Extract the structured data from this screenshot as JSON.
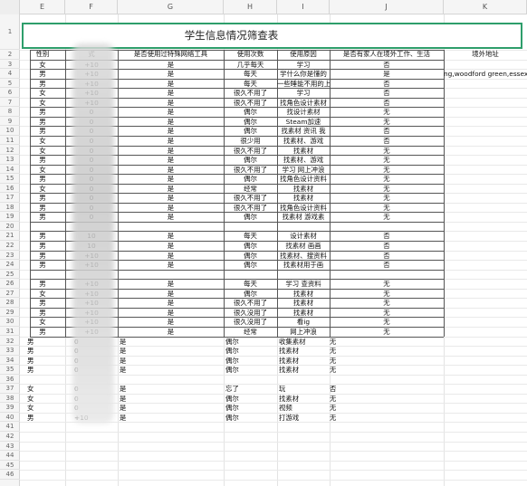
{
  "columns": [
    "E",
    "F",
    "G",
    "H",
    "I",
    "J",
    "K"
  ],
  "row_numbers": [
    "1",
    "2",
    "3",
    "4",
    "5",
    "6",
    "7",
    "8",
    "9",
    "10",
    "11",
    "12",
    "13",
    "14",
    "15",
    "16",
    "17",
    "18",
    "19",
    "20",
    "21",
    "22",
    "23",
    "24",
    "25",
    "26",
    "27",
    "28",
    "29",
    "30",
    "31",
    "32",
    "33",
    "34",
    "35",
    "36",
    "37",
    "38",
    "39",
    "40",
    "41",
    "42",
    "43",
    "44",
    "45",
    "46"
  ],
  "title": "学生信息情况筛查表",
  "headers": {
    "gender": "性别",
    "mode": "式",
    "used_tool": "是否使用过特殊网络工具",
    "frequency": "使用次数",
    "reason": "使用原因",
    "family_abroad": "是否有家人在境外工作、生活",
    "overseas_addr": "境外地址"
  },
  "rows": [
    {
      "g": "女",
      "f": "+10",
      "u": "是",
      "n": "几乎每天",
      "r": "学习",
      "a": "否",
      "o": ""
    },
    {
      "g": "男",
      "f": "+10",
      "u": "是",
      "n": "每天",
      "r": "学什么你是懂的",
      "a": "是",
      "o": "ng,woodford green,essex"
    },
    {
      "g": "男",
      "f": "+10",
      "u": "是",
      "n": "每天",
      "r": "一些睡能不用的上",
      "a": "否",
      "o": ""
    },
    {
      "g": "女",
      "f": "+10",
      "u": "是",
      "n": "很久不用了",
      "r": "学习",
      "a": "否",
      "o": ""
    },
    {
      "g": "女",
      "f": "+10",
      "u": "是",
      "n": "很久不用了",
      "r": "找角色设计素材",
      "a": "否",
      "o": ""
    },
    {
      "g": "男",
      "f": "0",
      "u": "是",
      "n": "偶尔",
      "r": "找设计素材",
      "a": "无",
      "o": ""
    },
    {
      "g": "男",
      "f": "0",
      "u": "是",
      "n": "偶尔",
      "r": "Steam加速",
      "a": "无",
      "o": ""
    },
    {
      "g": "男",
      "f": "0",
      "u": "是",
      "n": "偶尔",
      "r": "找素材 资讯 我",
      "a": "否",
      "o": ""
    },
    {
      "g": "女",
      "f": "0",
      "u": "是",
      "n": "很少用",
      "r": "找素材、游戏",
      "a": "否",
      "o": ""
    },
    {
      "g": "女",
      "f": "0",
      "u": "是",
      "n": "很久不用了",
      "r": "找素材",
      "a": "无",
      "o": ""
    },
    {
      "g": "男",
      "f": "0",
      "u": "是",
      "n": "偶尔",
      "r": "找素材、游戏",
      "a": "无",
      "o": ""
    },
    {
      "g": "女",
      "f": "0",
      "u": "是",
      "n": "很久不用了",
      "r": "学习 网上冲浪",
      "a": "无",
      "o": ""
    },
    {
      "g": "男",
      "f": "0",
      "u": "是",
      "n": "偶尔",
      "r": "找角色设计资料",
      "a": "无",
      "o": ""
    },
    {
      "g": "女",
      "f": "0",
      "u": "是",
      "n": "经常",
      "r": "找素材",
      "a": "无",
      "o": ""
    },
    {
      "g": "男",
      "f": "0",
      "u": "是",
      "n": "很久不用了",
      "r": "找素材",
      "a": "无",
      "o": ""
    },
    {
      "g": "男",
      "f": "0",
      "u": "是",
      "n": "很久不用了",
      "r": "找角色设计资料",
      "a": "无",
      "o": ""
    },
    {
      "g": "男",
      "f": "0",
      "u": "是",
      "n": "偶尔",
      "r": "找素材 游戏素",
      "a": "无",
      "o": ""
    },
    {
      "g": "",
      "f": "",
      "u": "",
      "n": "",
      "r": "",
      "a": "",
      "o": ""
    },
    {
      "g": "男",
      "f": "10",
      "u": "是",
      "n": "每天",
      "r": "设计素材",
      "a": "否",
      "o": ""
    },
    {
      "g": "男",
      "f": "10",
      "u": "是",
      "n": "偶尔",
      "r": "找素材 画画",
      "a": "否",
      "o": ""
    },
    {
      "g": "男",
      "f": "+10",
      "u": "是",
      "n": "偶尔",
      "r": "找素材、搜资料",
      "a": "否",
      "o": ""
    },
    {
      "g": "男",
      "f": "+10",
      "u": "是",
      "n": "偶尔",
      "r": "找素材用于画",
      "a": "否",
      "o": ""
    },
    {
      "g": "",
      "f": "",
      "u": "",
      "n": "",
      "r": "",
      "a": "",
      "o": ""
    },
    {
      "g": "男",
      "f": "+10",
      "u": "是",
      "n": "每天",
      "r": "学习 查资料",
      "a": "无",
      "o": ""
    },
    {
      "g": "女",
      "f": "+10",
      "u": "是",
      "n": "偶尔",
      "r": "找素材",
      "a": "无",
      "o": ""
    },
    {
      "g": "男",
      "f": "+10",
      "u": "是",
      "n": "很久不用了",
      "r": "找素材",
      "a": "无",
      "o": ""
    },
    {
      "g": "男",
      "f": "+10",
      "u": "是",
      "n": "很久没用了",
      "r": "找素材",
      "a": "无",
      "o": ""
    },
    {
      "g": "女",
      "f": "+10",
      "u": "是",
      "n": "很久没用了",
      "r": "看ig",
      "a": "无",
      "o": ""
    },
    {
      "g": "男",
      "f": "+10",
      "u": "是",
      "n": "经常",
      "r": "网上冲浪",
      "a": "无",
      "o": ""
    }
  ],
  "rows_plain": [
    {
      "g": "男",
      "f": "0",
      "u": "是",
      "n": "偶尔",
      "r": "收集素材",
      "a": "无"
    },
    {
      "g": "男",
      "f": "0",
      "u": "是",
      "n": "偶尔",
      "r": "找素材",
      "a": "无"
    },
    {
      "g": "男",
      "f": "0",
      "u": "是",
      "n": "偶尔",
      "r": "找素材",
      "a": "无"
    },
    {
      "g": "男",
      "f": "0",
      "u": "是",
      "n": "偶尔",
      "r": "找素材",
      "a": "无"
    },
    {
      "g": "",
      "f": "",
      "u": "",
      "n": "",
      "r": "",
      "a": ""
    },
    {
      "g": "女",
      "f": "0",
      "u": "是",
      "n": "忘了",
      "r": "玩",
      "a": "否"
    },
    {
      "g": "女",
      "f": "0",
      "u": "是",
      "n": "偶尔",
      "r": "找素材",
      "a": "无"
    },
    {
      "g": "女",
      "f": "0",
      "u": "是",
      "n": "偶尔",
      "r": "视频",
      "a": "无"
    },
    {
      "g": "男",
      "f": "+10",
      "u": "是",
      "n": "偶尔",
      "r": "打游戏",
      "a": "无"
    }
  ]
}
